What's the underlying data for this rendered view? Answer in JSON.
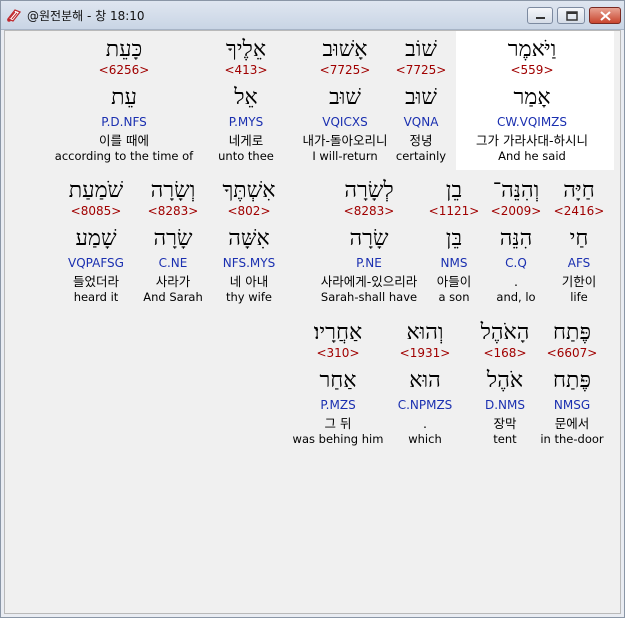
{
  "window": {
    "title": "@원전분해 - 창 18:10"
  },
  "rows": [
    [
      {
        "heb": "וַיֹּאמֶר",
        "num": "<559>",
        "root": "אָמַר",
        "parse": "CW.VQIMZS",
        "kor": "그가 가라사대-하시니",
        "eng": "And he said",
        "selected": true
      },
      {
        "heb": "שׁוֹב",
        "num": "<7725>",
        "root": "שׁוּב",
        "parse": "VQNA",
        "kor": "정녕",
        "eng": "certainly"
      },
      {
        "heb": "אָשׁוּב",
        "num": "<7725>",
        "root": "שׁוּב",
        "parse": "VQICXS",
        "kor": "내가-돌아오리니",
        "eng": "I will-return"
      },
      {
        "heb": "אֵלֶיךָ",
        "num": "<413>",
        "root": "אֵל",
        "parse": "P.MYS",
        "kor": "네게로",
        "eng": "unto thee"
      },
      {
        "heb": "כָּעֵת",
        "num": "<6256>",
        "root": "עֵת",
        "parse": "P.D.NFS",
        "kor": "이를 때에",
        "eng": "according to the time of"
      }
    ],
    [
      {
        "heb": "חַיָּה",
        "num": "<2416>",
        "root": "חַי",
        "parse": "AFS",
        "kor": "기한이",
        "eng": "life"
      },
      {
        "heb": "וְהִנֵּה־",
        "num": "<2009>",
        "root": "הִנֵּה",
        "parse": "C.Q",
        "kor": ".",
        "eng": "and, lo"
      },
      {
        "heb": "בֵן",
        "num": "<1121>",
        "root": "בֵּן",
        "parse": "NMS",
        "kor": "아들이",
        "eng": "a son"
      },
      {
        "heb": "לְשָׂרָה",
        "num": "<8283>",
        "root": "שָׂרָה",
        "parse": "P.NE",
        "kor": "사라에게-있으리라",
        "eng": "Sarah-shall have"
      },
      {
        "heb": "אִשְׁתֶּךָ",
        "num": "<802>",
        "root": "אִשָּׁה",
        "parse": "NFS.MYS",
        "kor": "네 아내",
        "eng": "thy wife"
      },
      {
        "heb": "וְשָׂרָה",
        "num": "<8283>",
        "root": "שָׂרָה",
        "parse": "C.NE",
        "kor": "사라가",
        "eng": "And Sarah"
      },
      {
        "heb": "שֹׁמַעַת",
        "num": "<8085>",
        "root": "שָׁמַע",
        "parse": "VQPAFSG",
        "kor": "들었더라",
        "eng": "heard it"
      }
    ],
    [
      {
        "heb": "פֶּתַח",
        "num": "<6607>",
        "root": "פֶּתַח",
        "parse": "NMSG",
        "kor": "문에서",
        "eng": "in the-door"
      },
      {
        "heb": "הָאֹהֶל",
        "num": "<168>",
        "root": "אֹהֶל",
        "parse": "D.NMS",
        "kor": "장막",
        "eng": "tent"
      },
      {
        "heb": "וְהוּא",
        "num": "<1931>",
        "root": "הוּא",
        "parse": "C.NPMZS",
        "kor": ".",
        "eng": "which"
      },
      {
        "heb": "אַחֲרָיו׃",
        "num": "<310>",
        "root": "אַחַר",
        "parse": "P.MZS",
        "kor": "그 뒤",
        "eng": "was behing him"
      }
    ]
  ]
}
